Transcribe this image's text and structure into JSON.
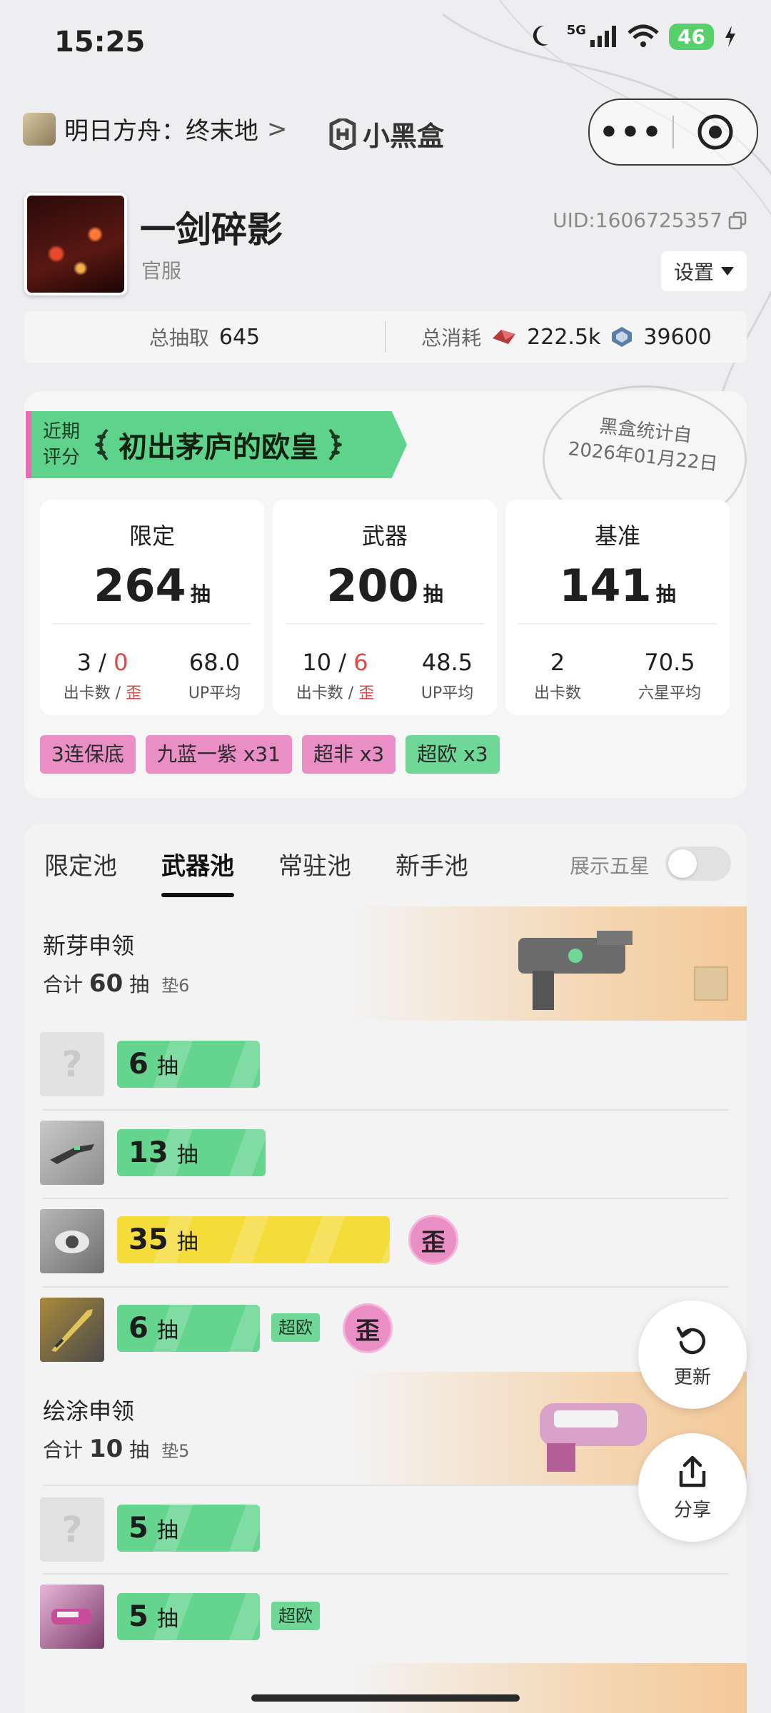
{
  "status_bar": {
    "time": "15:25",
    "network": "5G",
    "battery": "46"
  },
  "header": {
    "game": "明日方舟：终末地",
    "chevron": ">",
    "brand": "小黑盒",
    "more": "•••"
  },
  "profile": {
    "name": "一剑碎影",
    "server": "官服",
    "uid": "UID:1606725357",
    "settings": "设置"
  },
  "summary": {
    "total_pulls_label": "总抽取",
    "total_pulls": "645",
    "spend_label": "总消耗",
    "currency1": "222.5k",
    "currency2": "39600"
  },
  "rating": {
    "label_line1": "近期",
    "label_line2": "评分",
    "title": "初出茅庐的欧皇",
    "stamp_line1": "黑盒统计自",
    "stamp_line2": "2026年01月22日"
  },
  "stats": [
    {
      "title": "限定",
      "pulls": "264",
      "unit": "抽",
      "a": "3",
      "slash": "/",
      "b": "0",
      "a_label": "出卡数",
      "b_label": "歪",
      "avg": "68.0",
      "avg_label": "UP平均"
    },
    {
      "title": "武器",
      "pulls": "200",
      "unit": "抽",
      "a": "10",
      "slash": "/",
      "b": "6",
      "a_label": "出卡数",
      "b_label": "歪",
      "avg": "48.5",
      "avg_label": "UP平均"
    },
    {
      "title": "基准",
      "pulls": "141",
      "unit": "抽",
      "a": "2",
      "a_label": "出卡数",
      "avg": "70.5",
      "avg_label": "六星平均"
    }
  ],
  "tags": [
    "3连保底",
    "九蓝一紫 x31",
    "超非 x3",
    "超欧 x3"
  ],
  "tabs": [
    "限定池",
    "武器池",
    "常驻池",
    "新手池"
  ],
  "show_five_star": "展示五星",
  "pools": [
    {
      "title": "新芽申领",
      "total_prefix": "合计",
      "total": "60",
      "unit": "抽",
      "pad": "垫6",
      "rows": [
        {
          "pulls": "6",
          "unit": "抽"
        },
        {
          "pulls": "13",
          "unit": "抽"
        },
        {
          "pulls": "35",
          "unit": "抽",
          "wai": "歪"
        },
        {
          "pulls": "6",
          "unit": "抽",
          "tag": "超欧",
          "wai": "歪"
        }
      ]
    },
    {
      "title": "绘涂申领",
      "total_prefix": "合计",
      "total": "10",
      "unit": "抽",
      "pad": "垫5",
      "rows": [
        {
          "pulls": "5",
          "unit": "抽"
        },
        {
          "pulls": "5",
          "unit": "抽",
          "tag": "超欧"
        }
      ]
    }
  ],
  "fab": {
    "refresh": "更新",
    "share": "分享"
  },
  "colors": {
    "green": "#64d48e",
    "pink": "#ea8ec6",
    "yellow": "#f4dc3a",
    "red": "#d94a4a"
  }
}
